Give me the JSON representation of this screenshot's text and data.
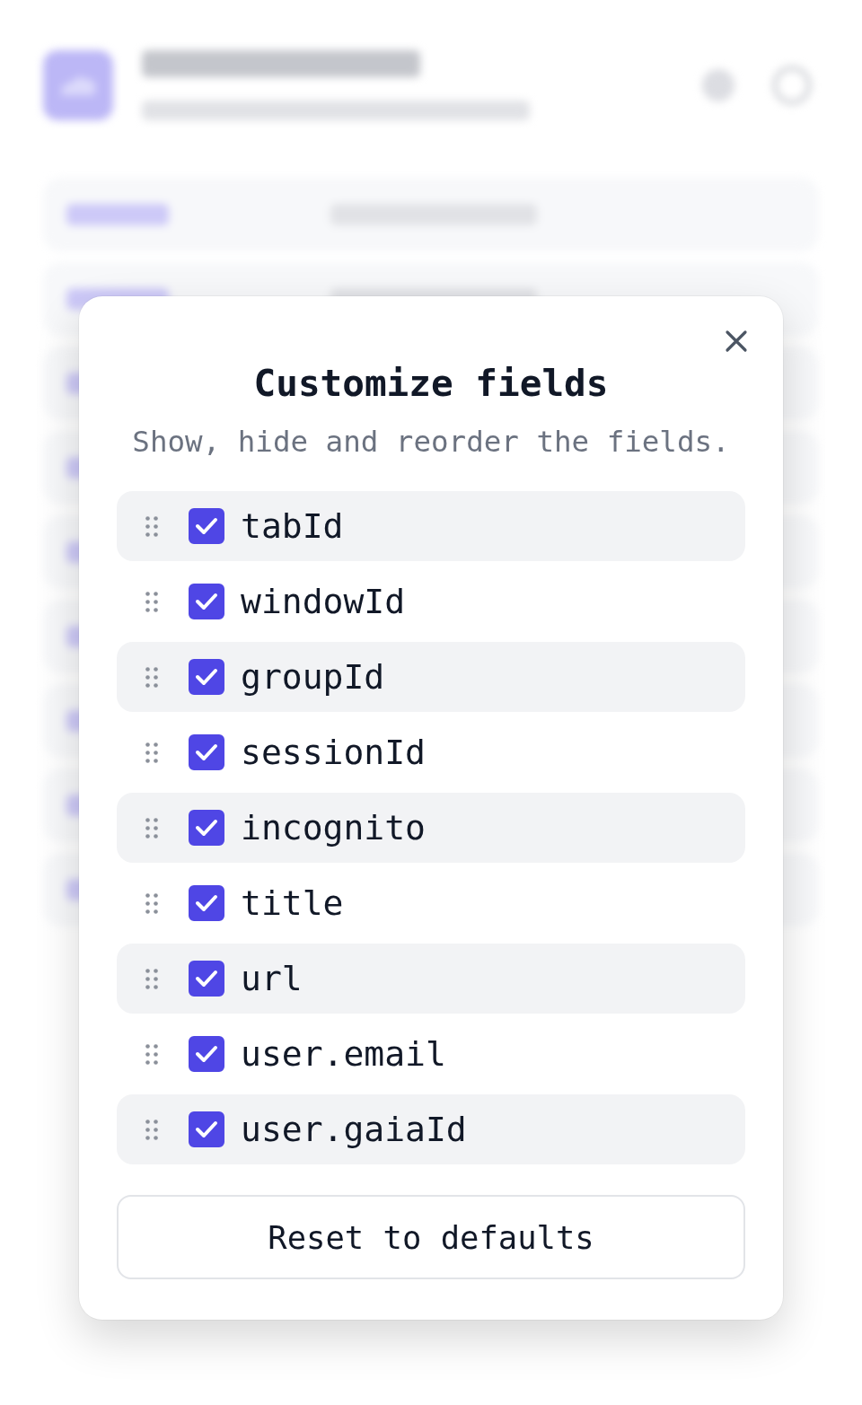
{
  "dialog": {
    "title": "Customize fields",
    "subtitle": "Show, hide and reorder the fields.",
    "fields": [
      {
        "label": "tabId",
        "checked": true
      },
      {
        "label": "windowId",
        "checked": true
      },
      {
        "label": "groupId",
        "checked": true
      },
      {
        "label": "sessionId",
        "checked": true
      },
      {
        "label": "incognito",
        "checked": true
      },
      {
        "label": "title",
        "checked": true
      },
      {
        "label": "url",
        "checked": true
      },
      {
        "label": "user.email",
        "checked": true
      },
      {
        "label": "user.gaiaId",
        "checked": true
      }
    ],
    "reset_button": "Reset to defaults"
  }
}
